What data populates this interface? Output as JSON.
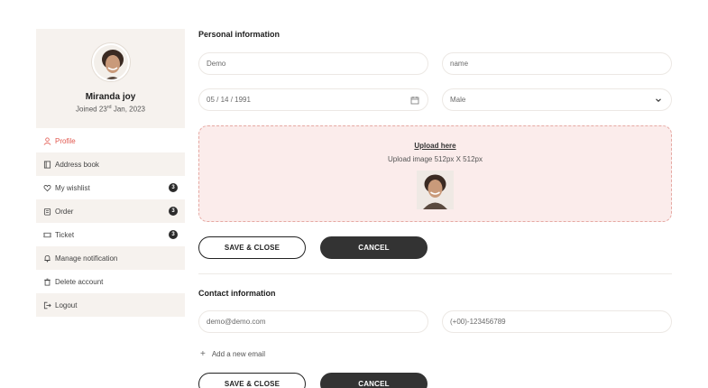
{
  "profile": {
    "name": "Miranda joy",
    "joined_prefix": "Joined 23",
    "joined_suffix": "rd",
    "joined_rest": " Jan, 2023"
  },
  "menu": {
    "items": [
      {
        "label": "Profile",
        "icon": "user-icon",
        "active": true
      },
      {
        "label": "Address book",
        "icon": "book-icon"
      },
      {
        "label": "My wishlist",
        "icon": "heart-icon",
        "badge": "3"
      },
      {
        "label": "Order",
        "icon": "order-icon",
        "badge": "3"
      },
      {
        "label": "Ticket",
        "icon": "ticket-icon",
        "badge": "3"
      },
      {
        "label": "Manage notification",
        "icon": "bell-icon"
      },
      {
        "label": "Delete account",
        "icon": "trash-icon"
      },
      {
        "label": "Logout",
        "icon": "logout-icon"
      }
    ]
  },
  "personal": {
    "title": "Personal information",
    "first_name": "Demo",
    "last_name": "name",
    "dob": "05 / 14 / 1991",
    "gender": "Male",
    "upload_link": "Upload here",
    "upload_hint": "Upload image 512px X 512px",
    "save_label": "SAVE & CLOSE",
    "cancel_label": "CANCEL"
  },
  "contact": {
    "title": "Contact information",
    "email": "demo@demo.com",
    "phone": "(+00)-123456789",
    "add_email": "Add a new email",
    "save_label": "SAVE & CLOSE",
    "cancel_label": "CANCEL"
  },
  "colors": {
    "accent": "#e2584f",
    "sidebar_bg": "#f6f2ee",
    "upload_bg": "#fbeceb",
    "dark_button": "#333333"
  }
}
